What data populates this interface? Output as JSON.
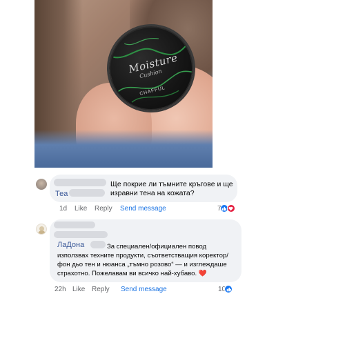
{
  "photo": {
    "brand_line1": "Moisture",
    "brand_line2": "Cushion",
    "brand_line3": "CHAFFUL"
  },
  "comments": [
    {
      "author": "Теа",
      "text": "Ще покрие ли тъмните кръгове и ще изравни тена на кожата?",
      "time": "1d",
      "like_label": "Like",
      "reply_label": "Reply",
      "send_label": "Send message",
      "reaction_count": "7",
      "reactions": [
        "like-icon",
        "love-icon"
      ]
    },
    {
      "author": "ЛаДона",
      "text": "За специален/официален повод използвах техните продукти, съответстващия коректор/фон дьо тен и нюанса „тъмно розово“ — и изглеждаше страхотно. Пожелавам ви всичко най-хубаво.",
      "emoji": "❤️",
      "time": "22h",
      "like_label": "Like",
      "reply_label": "Reply",
      "send_label": "Send message",
      "reaction_count": "10",
      "reactions": [
        "like-icon"
      ]
    }
  ],
  "colors": {
    "bubble": "#f0f2f5",
    "link": "#1b74e4",
    "meta": "#65676b",
    "like": "#1877f2",
    "love": "#e41e3f"
  }
}
